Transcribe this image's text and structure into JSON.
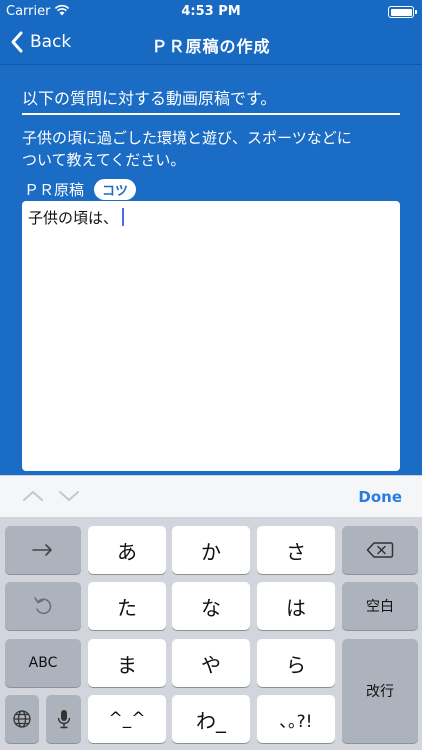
{
  "status": {
    "carrier": "Carrier",
    "time": "4:53 PM"
  },
  "nav": {
    "back_label": "Back",
    "title": "ＰＲ原稿の作成"
  },
  "content": {
    "question_title": "以下の質問に対する動画原稿です。",
    "question_line1": "子供の頃に過ごした環境と遊び、スポーツなどに",
    "question_line2": "ついて教えてください。",
    "pr_label": "ＰＲ原稿",
    "tip_label": "コツ",
    "editor_text": "子供の頃は、"
  },
  "accessory": {
    "done_label": "Done"
  },
  "keyboard": {
    "a": "あ",
    "ka": "か",
    "sa": "さ",
    "ta": "た",
    "na": "な",
    "ha": "は",
    "space": "空白",
    "abc": "ABC",
    "ma": "ま",
    "ya": "や",
    "ra": "ら",
    "enter": "改行",
    "dakuten": "^_^",
    "wa": "わ_",
    "punct": "､｡?!"
  }
}
